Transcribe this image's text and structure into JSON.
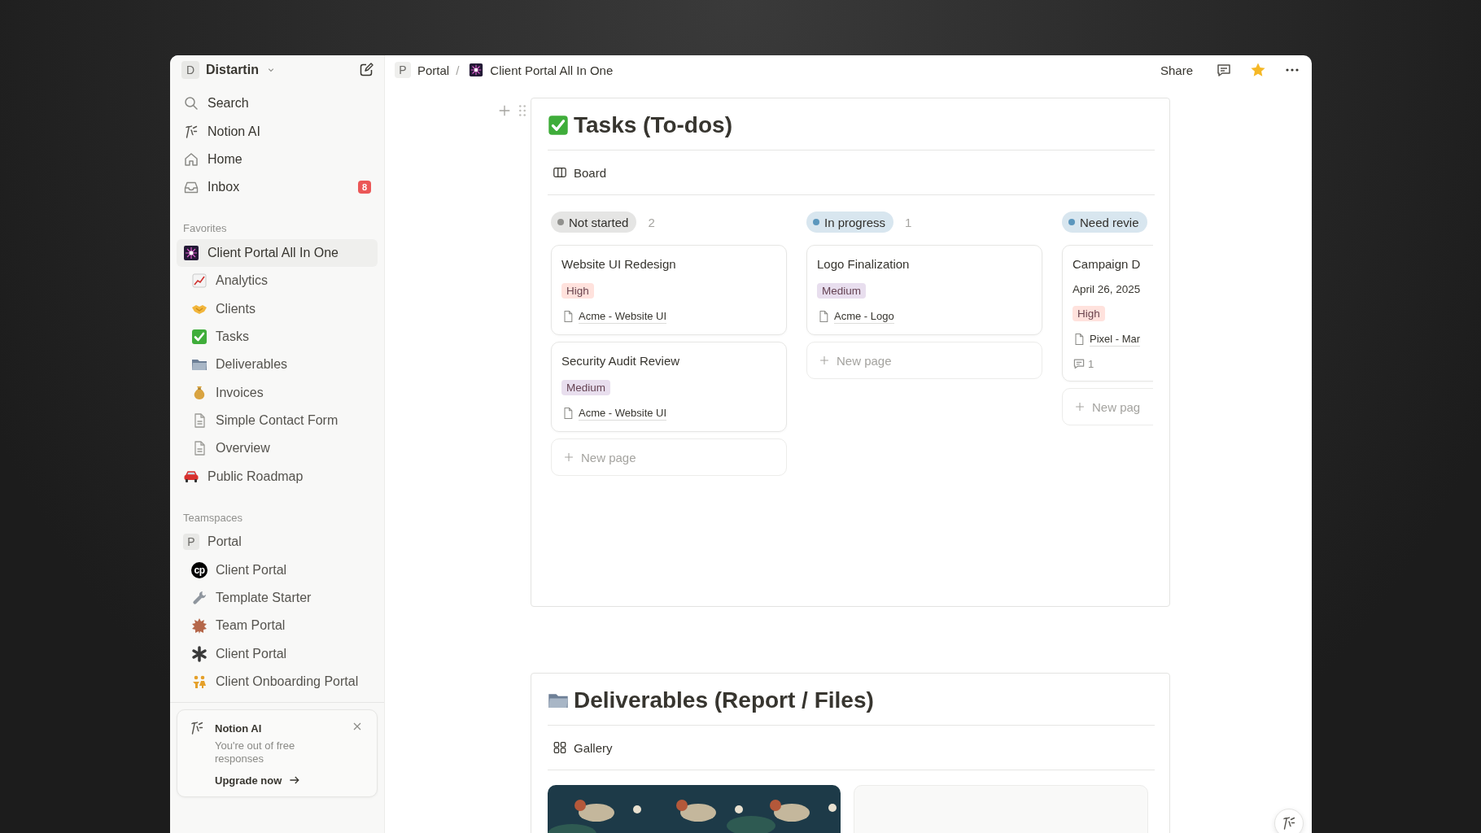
{
  "sidebar": {
    "workspace": {
      "initial": "D",
      "name": "Distartin"
    },
    "nav": [
      {
        "label": "Search"
      },
      {
        "label": "Notion AI"
      },
      {
        "label": "Home"
      },
      {
        "label": "Inbox",
        "badge": "8"
      }
    ],
    "favorites": {
      "heading": "Favorites",
      "items": [
        {
          "label": "Client Portal All In One",
          "selected": true,
          "children": [
            {
              "label": "Analytics",
              "selected": false
            },
            {
              "label": "Clients",
              "selected": false
            },
            {
              "label": "Tasks",
              "selected": false
            },
            {
              "label": "Deliverables",
              "selected": false
            },
            {
              "label": "Invoices",
              "selected": false
            },
            {
              "label": "Simple Contact Form",
              "selected": false
            },
            {
              "label": "Overview",
              "selected": false
            }
          ]
        },
        {
          "label": "Public Roadmap",
          "selected": false
        }
      ]
    },
    "teamspaces": {
      "heading": "Teamspaces",
      "items": [
        {
          "label": "Portal",
          "initial": "P",
          "selected": false,
          "children": [
            {
              "label": "Client Portal",
              "logo_text": "cp",
              "selected": false
            },
            {
              "label": "Template Starter",
              "selected": false
            },
            {
              "label": "Team Portal",
              "selected": false
            },
            {
              "label": "Client Portal",
              "selected": false
            },
            {
              "label": "Client Onboarding Portal",
              "selected": false
            }
          ]
        }
      ]
    },
    "ai_card": {
      "title": "Notion AI",
      "message": "You're out of free responses",
      "link": "Upgrade now"
    }
  },
  "topbar": {
    "breadcrumb": {
      "initial": "P",
      "items": [
        "Portal",
        "Client Portal All In One"
      ],
      "separator": "/"
    },
    "share": "Share",
    "favorite": true
  },
  "tasks": {
    "title": "Tasks (To-dos)",
    "view": "Board",
    "columns": [
      {
        "status": "Not started",
        "color": "#91918e",
        "count": "2",
        "new_page": "New page",
        "cards": [
          {
            "title": "Website UI Redesign",
            "tag": {
              "label": "High",
              "color": "#ffe2dd"
            },
            "relation": "Acme - Website UI"
          },
          {
            "title": "Security Audit Review",
            "tag": {
              "label": "Medium",
              "color": "#e8deee"
            },
            "relation": "Acme - Website UI"
          }
        ]
      },
      {
        "status": "In progress",
        "color": "#5b97bd",
        "count": "1",
        "new_page": "New page",
        "cards": [
          {
            "title": "Logo Finalization",
            "tag": {
              "label": "Medium",
              "color": "#e8deee"
            },
            "relation": "Acme - Logo"
          }
        ]
      },
      {
        "status": "Need revie",
        "color": "#5b97bd",
        "new_page": "New pag",
        "cards": [
          {
            "title": "Campaign D",
            "date": "April 26, 2025",
            "tag": {
              "label": "High",
              "color": "#ffe2dd"
            },
            "relation": "Pixel - Mar",
            "comments": "1"
          }
        ]
      }
    ]
  },
  "deliverables": {
    "title": "Deliverables (Report / Files)",
    "view": "Gallery",
    "cards": [
      {
        "kind": "picture"
      },
      {
        "kind": "blank"
      }
    ]
  }
}
